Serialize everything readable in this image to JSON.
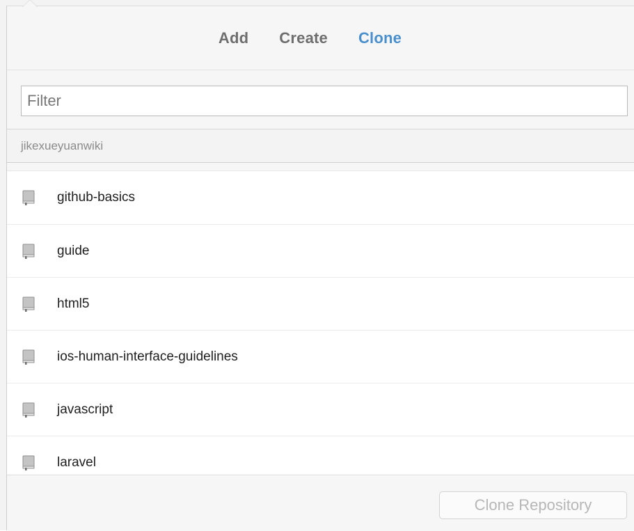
{
  "tabs": [
    {
      "label": "Add",
      "active": false
    },
    {
      "label": "Create",
      "active": false
    },
    {
      "label": "Clone",
      "active": true
    }
  ],
  "filter": {
    "placeholder": "Filter",
    "value": ""
  },
  "section": {
    "title": "jikexueyuanwiki"
  },
  "repositories": [
    {
      "name": "github-basics",
      "icon": "book-icon"
    },
    {
      "name": "guide",
      "icon": "book-icon"
    },
    {
      "name": "html5",
      "icon": "book-icon"
    },
    {
      "name": "ios-human-interface-guidelines",
      "icon": "book-icon"
    },
    {
      "name": "javascript",
      "icon": "book-icon"
    },
    {
      "name": "laravel",
      "icon": "book-icon"
    }
  ],
  "footer": {
    "clone_button_label": "Clone Repository",
    "clone_button_enabled": false
  },
  "colors": {
    "accent": "#4a8fcd",
    "tab_inactive": "#6e6e6e",
    "disabled_text": "#b7b7b7"
  }
}
